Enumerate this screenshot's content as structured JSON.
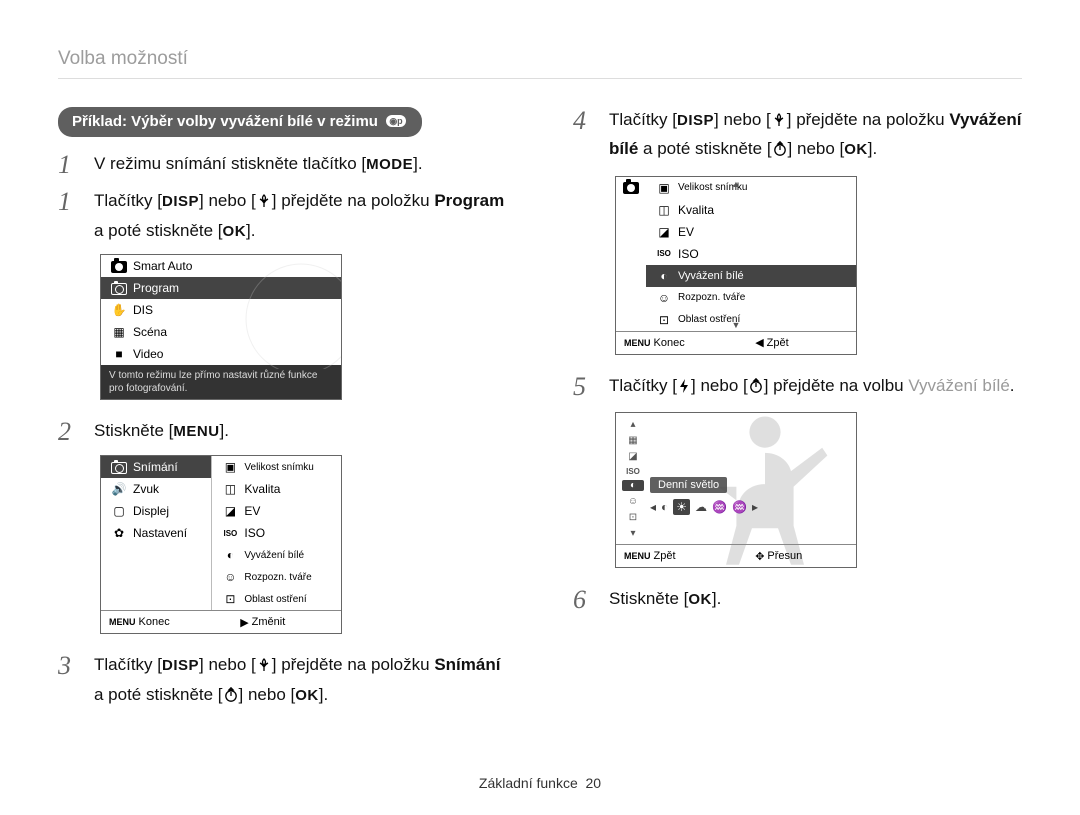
{
  "breadcrumb": "Volba možností",
  "pill": "Příklad: Výběr volby vyvážení bílé v režimu",
  "left": {
    "step1a_pre": "V režimu snímání stiskněte tlačítko [",
    "step1a_btn": "MODE",
    "step1a_post": "].",
    "step1b_pre": "Tlačítky [",
    "step1b_btn1": "DISP",
    "step1b_mid": "] nebo [",
    "step1b_post1": "] přejděte na položku ",
    "step1b_bold": "Program",
    "step1b_post2": " a poté stiskněte [",
    "step1b_ok": "OK",
    "step1b_end": "].",
    "lcd1": {
      "items": [
        "Smart Auto",
        "Program",
        "DIS",
        "Scéna",
        "Video"
      ],
      "hint": "V tomto režimu lze přímo nastavit různé funkce pro fotografování."
    },
    "step2_pre": "Stiskněte [",
    "step2_btn": "MENU",
    "step2_post": "].",
    "lcd2": {
      "left": [
        "Snímání",
        "Zvuk",
        "Displej",
        "Nastavení"
      ],
      "right": [
        "Velikost snímku",
        "Kvalita",
        "EV",
        "ISO",
        "Vyvážení bílé",
        "Rozpozn. tváře",
        "Oblast ostření"
      ],
      "barLeftLabel": "MENU",
      "barLeftText": "Konec",
      "barRightText": "Změnit"
    },
    "step3_pre": "Tlačítky [",
    "step3_btn1": "DISP",
    "step3_mid": "] nebo [",
    "step3_post1": "] přejděte na položku ",
    "step3_bold": "Snímání",
    "step3_post2": " a poté stiskněte [",
    "step3_mid2": "] nebo [",
    "step3_ok": "OK",
    "step3_end": "]."
  },
  "right": {
    "step4_pre": "Tlačítky [",
    "step4_btn1": "DISP",
    "step4_mid": "] nebo [",
    "step4_post1": "] přejděte na položku ",
    "step4_bold1": "Vyvážení bílé",
    "step4_post2": " a poté stiskněte [",
    "step4_mid2": "] nebo [",
    "step4_ok": "OK",
    "step4_end": "].",
    "lcd3": {
      "right": [
        "Velikost snímku",
        "Kvalita",
        "EV",
        "ISO",
        "Vyvážení bílé",
        "Rozpozn. tváře",
        "Oblast ostření"
      ],
      "barLeftLabel": "MENU",
      "barLeftText": "Konec",
      "barRightText": "Zpět"
    },
    "step5_pre": "Tlačítky [",
    "step5_mid": "] nebo [",
    "step5_post": "] přejděte na volbu ",
    "step5_gray": "Vyvážení bílé",
    "step5_end": ".",
    "lcd4": {
      "label": "Denní světlo",
      "barLeftLabel": "MENU",
      "barLeftText": "Zpět",
      "barRightText": "Přesun"
    },
    "step6_pre": "Stiskněte [",
    "step6_ok": "OK",
    "step6_post": "]."
  },
  "footer_label": "Základní funkce",
  "footer_page": "20"
}
